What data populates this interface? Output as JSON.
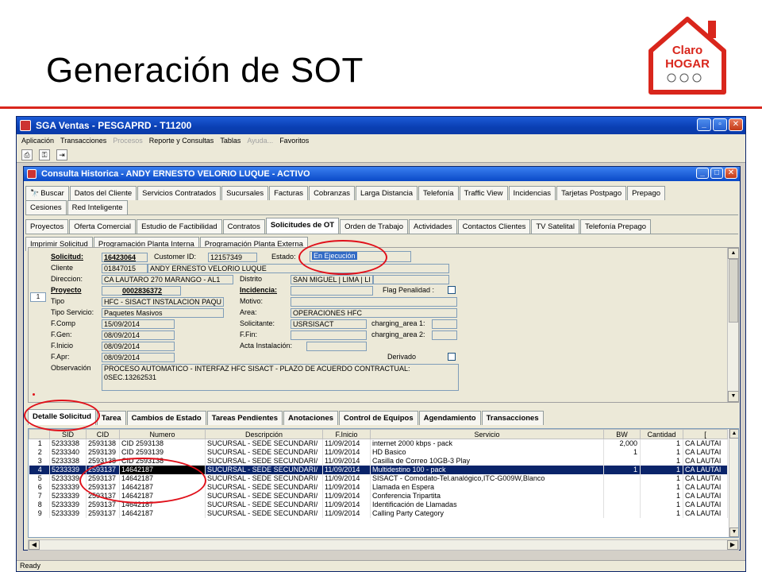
{
  "slide": {
    "title": "Generación de SOT"
  },
  "logo": {
    "line1": "Claro",
    "line2": "HOGAR",
    "brand_color": "#d9261c"
  },
  "app": {
    "title": "SGA Ventas - PESGAPRD - T11200",
    "menu": [
      "Aplicación",
      "Transacciones",
      "Procesos",
      "Reporte y Consultas",
      "Tablas",
      "Ayuda...",
      "Favoritos"
    ],
    "menu_disabled": [
      "Procesos",
      "Ayuda..."
    ],
    "status": "Ready"
  },
  "inner": {
    "title": "Consulta Historica - ANDY ERNESTO VELORIO LUQUE - ACTIVO",
    "tabs_row1": [
      "Buscar",
      "Datos del Cliente",
      "Servicios Contratados",
      "Sucursales",
      "Facturas",
      "Cobranzas",
      "Larga Distancia",
      "Telefonía",
      "Traffic View",
      "Incidencias",
      "Tarjetas Postpago",
      "Prepago"
    ],
    "tabs_row2": [
      "Cesiones",
      "Red Inteligente"
    ],
    "tabs_row3": [
      "Proyectos",
      "Oferta Comercial",
      "Estudio de Factibilidad",
      "Contratos",
      "Solicitudes de OT",
      "Orden de Trabajo",
      "Actividades",
      "Contactos Clientes",
      "TV Satelital",
      "Telefonía Prepago"
    ],
    "tabs_row4": [
      "Imprimir Solicitud",
      "Programación Planta Interna",
      "Programación Planta Externa"
    ],
    "bottom_tabs": [
      "Detalle Solicitud",
      "Tarea",
      "Cambios de Estado",
      "Tareas Pendientes",
      "Anotaciones",
      "Control de Equipos",
      "Agendamiento",
      "Transacciones"
    ]
  },
  "form": {
    "row_number": "1",
    "solicitud_label": "Solicitud:",
    "solicitud": "16423064",
    "customer_id_label": "Customer ID:",
    "customer_id": "12157349",
    "estado_label": "Estado:",
    "estado": "En Ejecución",
    "cliente_label": "Cliente",
    "cliente_code": "01847015",
    "cliente_name": "ANDY ERNESTO VELORIO LUQUE",
    "direccion_label": "Direccion:",
    "direccion": "CA LAUTARO 270  MARANGO - AL1",
    "distrito_label": "Distrito",
    "distrito": "SAN MIGUEL | LIMA | LI",
    "proyecto_label": "Proyecto",
    "proyecto": "0002836372",
    "incidencia_label": "Incidencia:",
    "flag_label": "Flag Penalidad :",
    "tipo_label": "Tipo",
    "tipo": "HFC - SISACT INSTALACION PAQU",
    "motivo_label": "Motivo:",
    "tipo_servicio_label": "Tipo Servicio:",
    "tipo_servicio": "Paquetes Masivos",
    "area_label": "Area:",
    "area": "OPERACIONES HFC",
    "fcomp_label": "F.Comp",
    "fcomp": "15/09/2014",
    "solicitante_label": "Solicitante:",
    "solicitante": "USRSISACT",
    "charging1_label": "charging_area 1:",
    "fgen_label": "F.Gen:",
    "fgen": "08/09/2014",
    "ffin_label": "F.Fin:",
    "charging2_label": "charging_area 2:",
    "finicio_label": "F.Inicio",
    "finicio": "08/09/2014",
    "acta_label": "Acta Instalación:",
    "fapr_label": "F.Apr:",
    "fapr": "08/09/2014",
    "derivado_label": "Derivado",
    "observacion_label": "Observación",
    "observacion_1": "PROCESO AUTOMATICO - INTERFAZ HFC SISACT - PLAZO DE ACUERDO CONTRACTUAL:",
    "observacion_2": "0SEC.13262531"
  },
  "grid": {
    "headers": [
      "",
      "SID",
      "CID",
      "Numero",
      "Descripción",
      "F.Inicio",
      "Servicio",
      "BW",
      "Cantidad",
      "["
    ],
    "rows": [
      {
        "n": "1",
        "sid": "5233338",
        "cid": "2593138",
        "numero": "CID 2593138",
        "desc": "SUCURSAL - SEDE SECUNDARI/",
        "finicio": "11/09/2014",
        "servicio": "internet 2000 kbps - pack",
        "bw": "2,000",
        "cant": "1",
        "dir": "CA LAUTAI"
      },
      {
        "n": "2",
        "sid": "5233340",
        "cid": "2593139",
        "numero": "CID 2593139",
        "desc": "SUCURSAL - SEDE SECUNDARI/",
        "finicio": "11/09/2014",
        "servicio": "HD Basico",
        "bw": "1",
        "cant": "1",
        "dir": "CA LAUTAI"
      },
      {
        "n": "3",
        "sid": "5233338",
        "cid": "2593138",
        "numero": "CID 2593138",
        "desc": "SUCURSAL - SEDE SECUNDARI/",
        "finicio": "11/09/2014",
        "servicio": "Casilla de Correo 10GB-3 Play",
        "bw": "",
        "cant": "1",
        "dir": "CA LAUTAI"
      },
      {
        "n": "4",
        "sid": "5233339",
        "cid": "2593137",
        "numero": "14642187",
        "desc": "SUCURSAL - SEDE SECUNDARI/",
        "finicio": "11/09/2014",
        "servicio": "Multidestino 100 - pack",
        "bw": "1",
        "cant": "1",
        "dir": "CA LAUTAI"
      },
      {
        "n": "5",
        "sid": "5233339",
        "cid": "2593137",
        "numero": "14642187",
        "desc": "SUCURSAL - SEDE SECUNDARI/",
        "finicio": "11/09/2014",
        "servicio": "SISACT - Comodato-Tel.analógico,ITC-G009W,Blanco",
        "bw": "",
        "cant": "1",
        "dir": "CA LAUTAI"
      },
      {
        "n": "6",
        "sid": "5233339",
        "cid": "2593137",
        "numero": "14642187",
        "desc": "SUCURSAL - SEDE SECUNDARI/",
        "finicio": "11/09/2014",
        "servicio": "Llamada en Espera",
        "bw": "",
        "cant": "1",
        "dir": "CA LAUTAI"
      },
      {
        "n": "7",
        "sid": "5233339",
        "cid": "2593137",
        "numero": "14642187",
        "desc": "SUCURSAL - SEDE SECUNDARI/",
        "finicio": "11/09/2014",
        "servicio": "Conferencia Tripartita",
        "bw": "",
        "cant": "1",
        "dir": "CA LAUTAI"
      },
      {
        "n": "8",
        "sid": "5233339",
        "cid": "2593137",
        "numero": "14642187",
        "desc": "SUCURSAL - SEDE SECUNDARI/",
        "finicio": "11/09/2014",
        "servicio": "Identificación de Llamadas",
        "bw": "",
        "cant": "1",
        "dir": "CA LAUTAI"
      },
      {
        "n": "9",
        "sid": "5233339",
        "cid": "2593137",
        "numero": "14642187",
        "desc": "SUCURSAL - SEDE SECUNDARI/",
        "finicio": "11/09/2014",
        "servicio": "Calling Party Category",
        "bw": "",
        "cant": "1",
        "dir": "CA LAUTAI"
      }
    ],
    "highlight_row": "4"
  }
}
